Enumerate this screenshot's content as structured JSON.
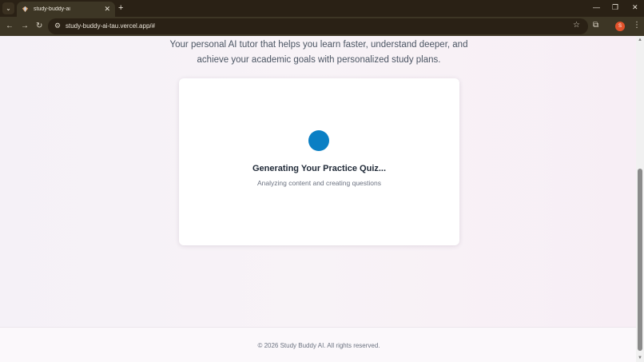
{
  "browser": {
    "tab": {
      "title": "study-buddy-ai",
      "close": "✕"
    },
    "tab_menu": "⌄",
    "new_tab": "+",
    "window_controls": {
      "minimize": "—",
      "restore": "❐",
      "close": "✕"
    },
    "nav": {
      "back": "←",
      "forward": "→",
      "reload": "↻"
    },
    "url": "study-buddy-ai-tau.vercel.app/#",
    "site_info_icon": "⚙",
    "bookmark_icon": "☆",
    "extensions_icon": "⧉",
    "profile_initial": "S",
    "menu_icon": "⋮"
  },
  "hero": {
    "tagline_line1": "Your personal AI tutor that helps you learn faster, understand deeper, and",
    "tagline_line2": "achieve your academic goals with personalized study plans."
  },
  "loading_card": {
    "title": "Generating Your Practice Quiz...",
    "subtitle": "Analyzing content and creating questions"
  },
  "footer": {
    "copyright": "© 2026 Study Buddy AI. All rights reserved."
  },
  "colors": {
    "spinner": "#0a7fc4",
    "chrome_dark": "#2a2115",
    "chrome_toolbar": "#3d3625",
    "profile": "#e2522b"
  }
}
